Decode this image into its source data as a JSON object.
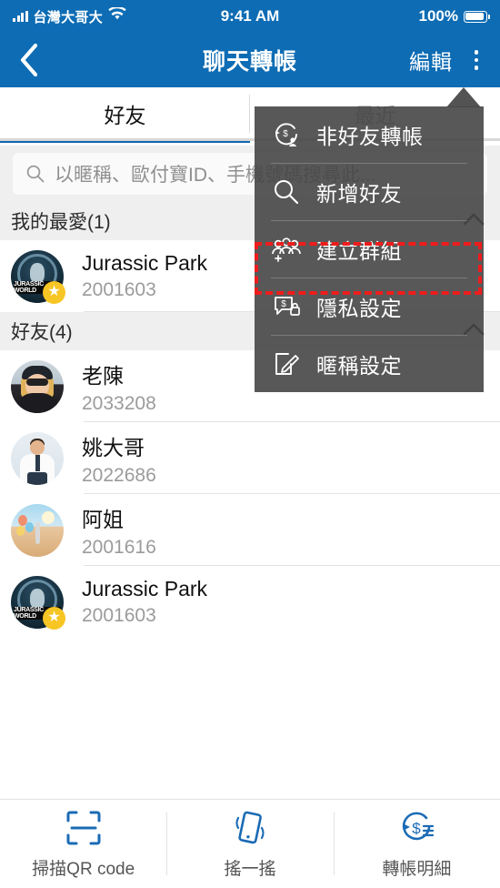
{
  "status_bar": {
    "carrier": "台灣大哥大",
    "time": "9:41 AM",
    "battery": "100%",
    "signal_icon": "signal-bars-icon",
    "wifi_icon": "wifi-icon",
    "battery_icon": "battery-full-icon"
  },
  "nav": {
    "back_icon": "chevron-left-icon",
    "title": "聊天轉帳",
    "edit_label": "編輯",
    "more_icon": "kebab-menu-icon"
  },
  "tabs": [
    {
      "label": "好友",
      "active": true
    },
    {
      "label": "最近",
      "active": false
    }
  ],
  "search": {
    "icon": "search-icon",
    "placeholder": "以暱稱、歐付寶ID、手機號碼搜尋此..."
  },
  "sections": [
    {
      "title": "我的最愛(1)",
      "collapse_icon": "chevron-up-icon",
      "rows": [
        {
          "name": "Jurassic Park",
          "id": "2001603",
          "avatar": "jurassic-park-logo",
          "favorite": true,
          "star_icon": "star-icon"
        }
      ]
    },
    {
      "title": "好友(4)",
      "collapse_icon": "chevron-up-icon",
      "rows": [
        {
          "name": "老陳",
          "id": "2033208",
          "avatar": "woman-sunglasses-photo",
          "favorite": false
        },
        {
          "name": "姚大哥",
          "id": "2022686",
          "avatar": "man-suit-photo",
          "favorite": false
        },
        {
          "name": "阿姐",
          "id": "2001616",
          "avatar": "beach-balloons-photo",
          "favorite": false
        },
        {
          "name": "Jurassic Park",
          "id": "2001603",
          "avatar": "jurassic-park-logo",
          "favorite": true,
          "star_icon": "star-icon"
        }
      ]
    }
  ],
  "menu": {
    "items": [
      {
        "label": "非好友轉帳",
        "icon": "transfer-nonfriend-icon",
        "highlighted": false
      },
      {
        "label": "新增好友",
        "icon": "search-add-friend-icon",
        "highlighted": false
      },
      {
        "label": "建立群組",
        "icon": "create-group-icon",
        "highlighted": true
      },
      {
        "label": "隱私設定",
        "icon": "privacy-lock-icon",
        "highlighted": false
      },
      {
        "label": "暱稱設定",
        "icon": "edit-nickname-icon",
        "highlighted": false
      }
    ],
    "highlight_color": "#ef1c1c"
  },
  "bottom_bar": [
    {
      "label": "掃描QR code",
      "icon": "qr-scan-icon"
    },
    {
      "label": "搖一搖",
      "icon": "shake-phone-icon"
    },
    {
      "label": "轉帳明細",
      "icon": "transfer-history-icon"
    }
  ],
  "colors": {
    "brand_blue": "#0d6cb4",
    "tab_underline": "#1166b0",
    "menu_bg": "#464646",
    "star_yellow": "#f7c524",
    "highlight_red": "#ef1c1c"
  }
}
